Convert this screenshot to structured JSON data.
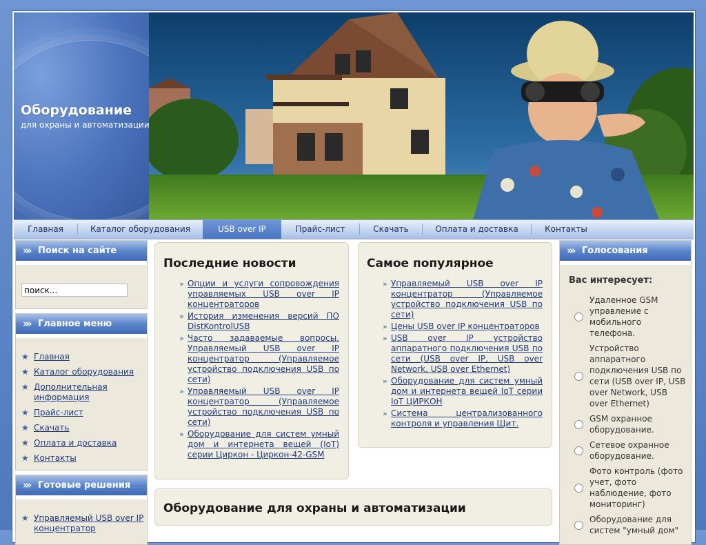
{
  "header": {
    "title": "Оборудование",
    "subtitle": "для охраны и автоматизации"
  },
  "nav": {
    "items": [
      {
        "label": "Главная"
      },
      {
        "label": "Каталог оборудования"
      },
      {
        "label": "USB over IP"
      },
      {
        "label": "Прайс-лист"
      },
      {
        "label": "Скачать"
      },
      {
        "label": "Оплата и доставка"
      },
      {
        "label": "Контакты"
      }
    ],
    "active_index": 2
  },
  "search": {
    "heading": "Поиск на сайте",
    "value": "поиск..."
  },
  "main_menu": {
    "heading": "Главное меню",
    "items": [
      "Главная",
      "Каталог оборудования",
      "Дополнительная информация",
      "Прайс-лист",
      "Скачать",
      "Оплата и доставка",
      "Контакты"
    ]
  },
  "solutions": {
    "heading": "Готовые решения",
    "items": [
      "Управляемый USB over IP концентратор"
    ]
  },
  "latest_news": {
    "heading": "Последние новости",
    "items": [
      "Опции и услуги сопровождения управляемых USB over IP концентраторов",
      "История изменения версий ПО DistKontrolUSB",
      "Часто задаваемые вопросы. Управляемый USB over IP концентратор (Управляемое устройство подключения USB по сети)",
      "Управляемый USB over IP концентратор (Управляемое устройство подключения USB по сети)",
      "Оборудование для систем умный дом и интернета вещей (IoT) серии Циркон - Циркон-42-GSM"
    ]
  },
  "popular": {
    "heading": "Самое популярное",
    "items": [
      "Управляемый USB over IP концентратор (Управляемое устройство подключения USB по сети)",
      "Цены USB over IP концентраторов",
      "USB over IP устройство аппаратного подключения USB по сети (USB over IP, USB over Network, USB over Ethernet)",
      "Оборудование для систем умный дом и интернета вещей IoT серии IoT ЦИРКОН",
      "Система централизованного контроля и управления Щит."
    ]
  },
  "article": {
    "heading": "Оборудование для охраны и автоматизации"
  },
  "poll": {
    "heading": "Голосования",
    "question": "Вас интересует:",
    "options": [
      "Удаленное GSM управление с мобильного телефона.",
      "Устройство аппаратного подключения USB по сети (USB over IP, USB over Network, USB over Ethernet)",
      "GSM охранное оборудование.",
      "Сетевое охранное оборудование.",
      "Фото контроль (фото учет, фото наблюдение, фото мониторинг)",
      "Оборудование для систем \"умный дом\""
    ]
  },
  "colors": {
    "background": "#5a82c4",
    "nav_active": "#4a75c0",
    "box_bg": "#ece9dc",
    "link": "#1f3a7a"
  }
}
